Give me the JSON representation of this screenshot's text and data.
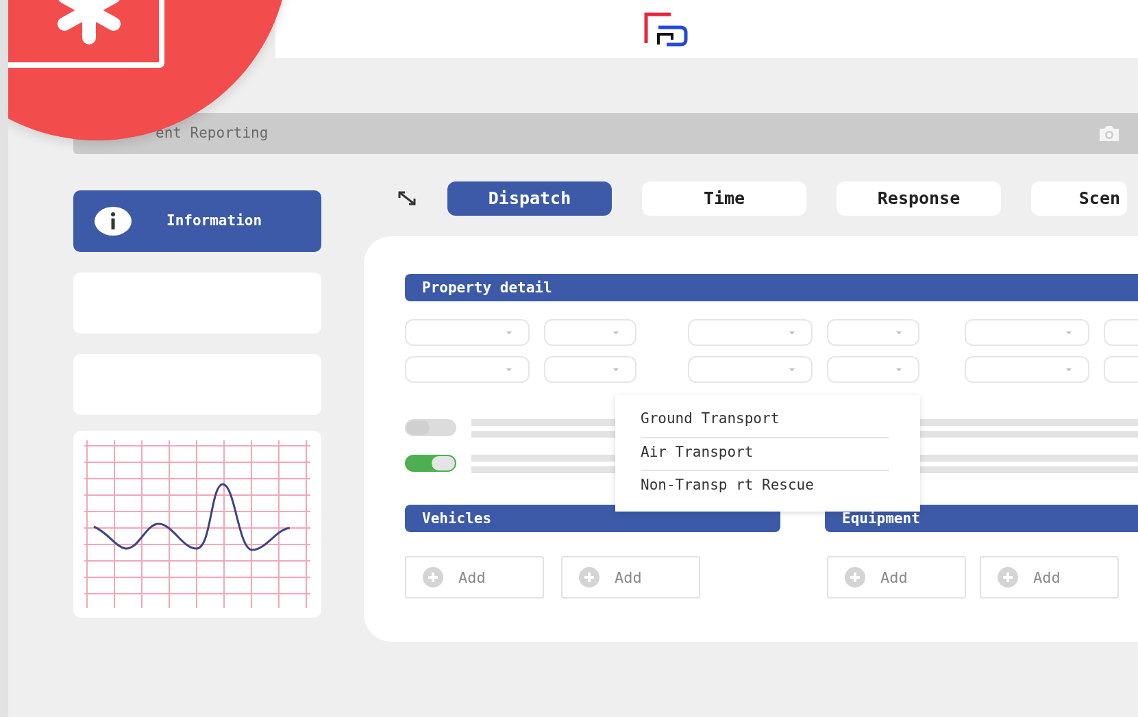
{
  "title_bar": {
    "title": "ent Reporting"
  },
  "sidebar": {
    "items": [
      {
        "label": "Information",
        "selected": true
      }
    ]
  },
  "tabs": [
    {
      "label": "Dispatch",
      "selected": true
    },
    {
      "label": "Time",
      "selected": false
    },
    {
      "label": "Response",
      "selected": false
    },
    {
      "label": "Scen",
      "selected": false
    }
  ],
  "property_detail": {
    "title": "Property detail",
    "toggles": [
      {
        "on": false
      },
      {
        "on": true
      }
    ]
  },
  "transport_menu": {
    "items": [
      "Ground Transport",
      "Air Transport",
      "Non-Transp rt Rescue"
    ]
  },
  "vehicles": {
    "title": "Vehicles",
    "buttons": [
      "Add",
      "Add"
    ]
  },
  "equipment": {
    "title": "Equipment",
    "buttons": [
      "Add",
      "Add"
    ]
  }
}
